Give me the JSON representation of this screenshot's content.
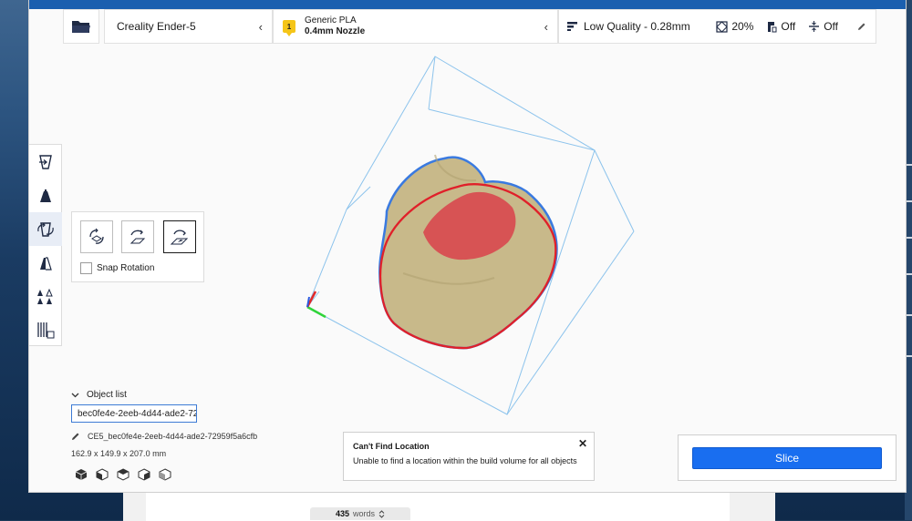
{
  "printer": {
    "name": "Creality Ender-5"
  },
  "material": {
    "extruder_number": "1",
    "name": "Generic PLA",
    "nozzle": "0.4mm Nozzle"
  },
  "print_settings": {
    "profile": "Low Quality - 0.28mm",
    "infill": "20%",
    "support": "Off",
    "adhesion": "Off"
  },
  "rotate_panel": {
    "snap_label": "Snap Rotation"
  },
  "object_list": {
    "heading": "Object list",
    "selected_value": "bec0fe4e-2eeb-4d44-ade2-72...",
    "object_name": "CE5_bec0fe4e-2eeb-4d44-ade2-72959f5a6cfb",
    "dimensions": "162.9 x 149.9 x 207.0 mm"
  },
  "toast": {
    "title": "Can't Find Location",
    "message": "Unable to find a location within the build volume for all objects"
  },
  "slice_panel": {
    "button_label": "Slice"
  },
  "background_app": {
    "word_count": "435",
    "word_label": "words"
  },
  "colors": {
    "accent_blue": "#196ef0",
    "header_band": "#1b5faf",
    "badge_yellow": "#f5c518",
    "model_fill": "#c8b98a",
    "overhang_red": "#d8484e"
  },
  "icons": [
    "folder-icon",
    "chevron-left-icon",
    "material-badge-icon",
    "profile-icon",
    "infill-icon",
    "support-icon",
    "adhesion-icon",
    "edit-icon",
    "move-tool-icon",
    "scale-tool-icon",
    "rotate-tool-icon",
    "mirror-tool-icon",
    "per-model-settings-icon",
    "support-blocker-icon",
    "reset-rotation-icon",
    "lay-flat-icon",
    "select-face-icon",
    "chevron-down-icon",
    "pencil-icon",
    "view-3d-icon",
    "view-front-icon",
    "view-top-icon",
    "view-left-icon",
    "view-right-icon",
    "close-icon",
    "updown-icon"
  ]
}
